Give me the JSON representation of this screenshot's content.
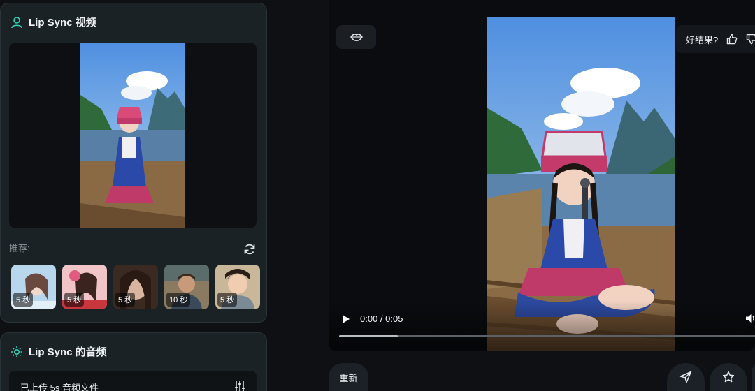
{
  "video_panel": {
    "title": "Lip Sync 视频",
    "recommend_label": "推荐:",
    "thumbnails": [
      {
        "duration": "5 秒"
      },
      {
        "duration": "5 秒"
      },
      {
        "duration": "5 秒"
      },
      {
        "duration": "10 秒"
      },
      {
        "duration": "5 秒"
      }
    ]
  },
  "audio_panel": {
    "title": "Lip Sync 的音频",
    "file_status": "已上传 5s 音频文件"
  },
  "player": {
    "feedback_prompt": "好结果?",
    "time": "0:00 / 0:05",
    "progress": 0.14
  },
  "actions": {
    "regenerate_label": "重新"
  },
  "colors": {
    "accent": "#2fd3b5"
  }
}
